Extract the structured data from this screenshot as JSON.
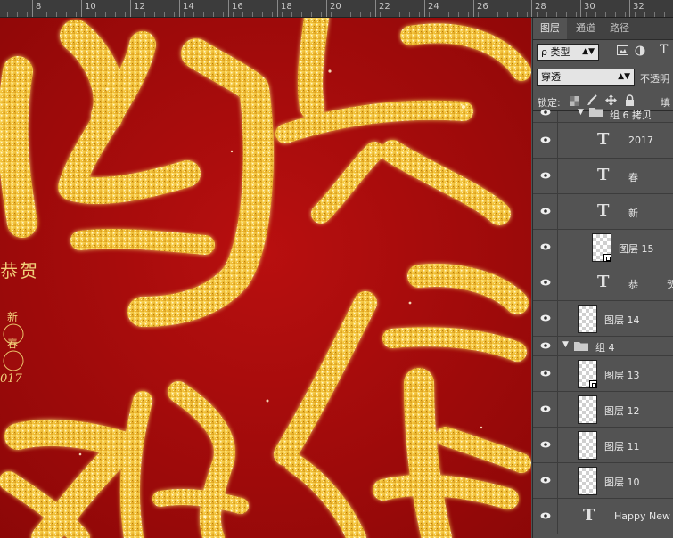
{
  "ruler": {
    "labels": [
      "8",
      "10",
      "12",
      "14",
      "16",
      "18",
      "20",
      "22",
      "24",
      "26",
      "28",
      "30",
      "32"
    ]
  },
  "canvas": {
    "side_text": {
      "line1": "恭贺",
      "seal1": "新",
      "seal2": "春",
      "year": "017"
    },
    "colors": {
      "background": "#a30b0b",
      "gold": "#f2c33c"
    }
  },
  "panel": {
    "tabs": [
      "图层",
      "通道",
      "路径"
    ],
    "filter": {
      "kind_label": "ρ 类型"
    },
    "blend_mode": "穿透",
    "opacity_label": "不透明",
    "lock_label": "锁定:",
    "fill_label": "填",
    "partial_group": "组 6 拷贝",
    "layers": [
      {
        "type": "text",
        "name": "2017"
      },
      {
        "type": "text",
        "name": "春"
      },
      {
        "type": "text",
        "name": "新"
      },
      {
        "type": "smart",
        "name": "图层 15"
      },
      {
        "type": "text",
        "name": "恭",
        "extra": "贺"
      },
      {
        "type": "pixel",
        "name": "图层 14"
      },
      {
        "type": "group",
        "name": "组 4"
      },
      {
        "type": "smart",
        "name": "图层 13"
      },
      {
        "type": "pixel",
        "name": "图层 12"
      },
      {
        "type": "pixel",
        "name": "图层 11"
      },
      {
        "type": "pixel",
        "name": "图层 10"
      },
      {
        "type": "text",
        "name": "Happy New Y"
      }
    ]
  }
}
